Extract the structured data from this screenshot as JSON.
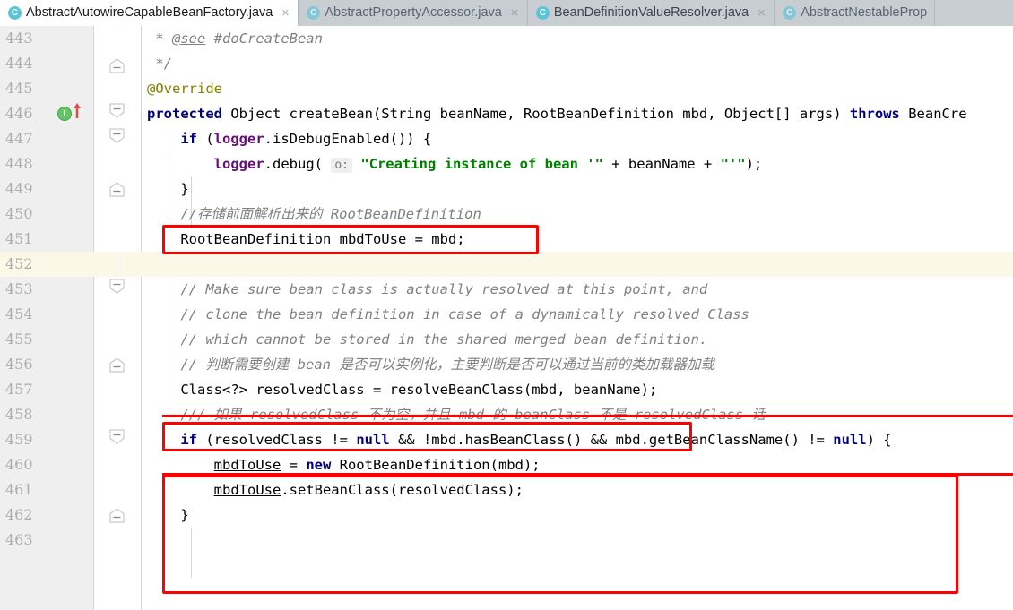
{
  "window": {
    "app": "IntelliJ IDEA code editor",
    "file_kind_icon": "java-class-icon"
  },
  "tabs": [
    {
      "label": "AbstractAutowireCapableBeanFactory.java",
      "icon": "java-class-icon",
      "icon_letter": "C",
      "active": true,
      "closable": true
    },
    {
      "label": "AbstractPropertyAccessor.java",
      "icon": "java-class-icon",
      "icon_letter": "C",
      "active": false,
      "closable": true
    },
    {
      "label": "BeanDefinitionValueResolver.java",
      "icon": "java-class-icon",
      "icon_letter": "C",
      "active": false,
      "closable": true
    },
    {
      "label": "AbstractNestableProp",
      "icon": "java-class-icon",
      "icon_letter": "C",
      "active": false,
      "closable": false
    }
  ],
  "tab_close_glyph": "×",
  "editor": {
    "current_line": 452,
    "first_line": 443,
    "last_line": 463,
    "colors": {
      "gutter_bg": "#efefef",
      "code_bg": "#ffffff",
      "current_line_bg": "#fcf8e8",
      "keyword": "#000080",
      "string": "#008000",
      "comment": "#808080",
      "annotation": "#808000",
      "field": "#660e7a",
      "line_number": "#adadad",
      "annotation_box": "#fe0000",
      "tabbar_bg": "#c8cdd2",
      "tab_icon": "#5bc4dd"
    },
    "lines": [
      {
        "n": 443,
        "text": " * @see #doCreateBean"
      },
      {
        "n": 444,
        "text": " */"
      },
      {
        "n": 445,
        "text": "@Override"
      },
      {
        "n": 446,
        "text": "protected Object createBean(String beanName, RootBeanDefinition mbd, Object[] args) throws BeanCre"
      },
      {
        "n": 447,
        "text": "    if (logger.isDebugEnabled()) {"
      },
      {
        "n": 448,
        "text": "        logger.debug( o: \"Creating instance of bean '\" + beanName + \"'\");"
      },
      {
        "n": 449,
        "text": "    }"
      },
      {
        "n": 450,
        "text": "    //存储前面解析出来的 RootBeanDefinition"
      },
      {
        "n": 451,
        "text": "    RootBeanDefinition mbdToUse = mbd;"
      },
      {
        "n": 452,
        "text": ""
      },
      {
        "n": 453,
        "text": "    // Make sure bean class is actually resolved at this point, and"
      },
      {
        "n": 454,
        "text": "    // clone the bean definition in case of a dynamically resolved Class"
      },
      {
        "n": 455,
        "text": "    // which cannot be stored in the shared merged bean definition."
      },
      {
        "n": 456,
        "text": "    // 判断需要创建 bean 是否可以实例化，主要判断是否可以通过当前的类加载器加载"
      },
      {
        "n": 457,
        "text": "    Class<?> resolvedClass = resolveBeanClass(mbd, beanName);"
      },
      {
        "n": 458,
        "text": "    /// 如果 resolvedClass 不为空，并且 mbd 的 beanClass 不是 resolvedClass 话"
      },
      {
        "n": 459,
        "text": "    if (resolvedClass != null && !mbd.hasBeanClass() && mbd.getBeanClassName() != null) {"
      },
      {
        "n": 460,
        "text": "        mbdToUse = new RootBeanDefinition(mbd);"
      },
      {
        "n": 461,
        "text": "        mbdToUse.setBeanClass(resolvedClass);"
      },
      {
        "n": 462,
        "text": "    }"
      },
      {
        "n": 463,
        "text": ""
      }
    ],
    "gutter_markers": [
      {
        "line": 446,
        "type": "implementing-method-marker",
        "glyph": "I",
        "arrow": "up",
        "color": "#62c462"
      }
    ],
    "fold_markers": [
      {
        "line": 444,
        "direction": "collapse-up"
      },
      {
        "line": 446,
        "direction": "collapse-down"
      },
      {
        "line": 447,
        "direction": "collapse-down"
      },
      {
        "line": 449,
        "direction": "collapse-up"
      },
      {
        "line": 453,
        "direction": "collapse-up"
      },
      {
        "line": 456,
        "direction": "collapse-up"
      },
      {
        "line": 459,
        "direction": "collapse-down"
      },
      {
        "line": 462,
        "direction": "collapse-up"
      }
    ],
    "annotations": [
      {
        "id": "box-mbdtouse-assign",
        "covers_lines": "451",
        "shape": "rectangle"
      },
      {
        "id": "underline-chinese-comment-456",
        "covers_lines": "456",
        "shape": "underline"
      },
      {
        "id": "box-resolved-class",
        "covers_lines": "457",
        "shape": "rectangle"
      },
      {
        "id": "underline-chinese-comment-458",
        "covers_lines": "458",
        "shape": "underline"
      },
      {
        "id": "box-if-resolvedclass-block",
        "covers_lines": "459-462",
        "shape": "rectangle"
      }
    ]
  }
}
